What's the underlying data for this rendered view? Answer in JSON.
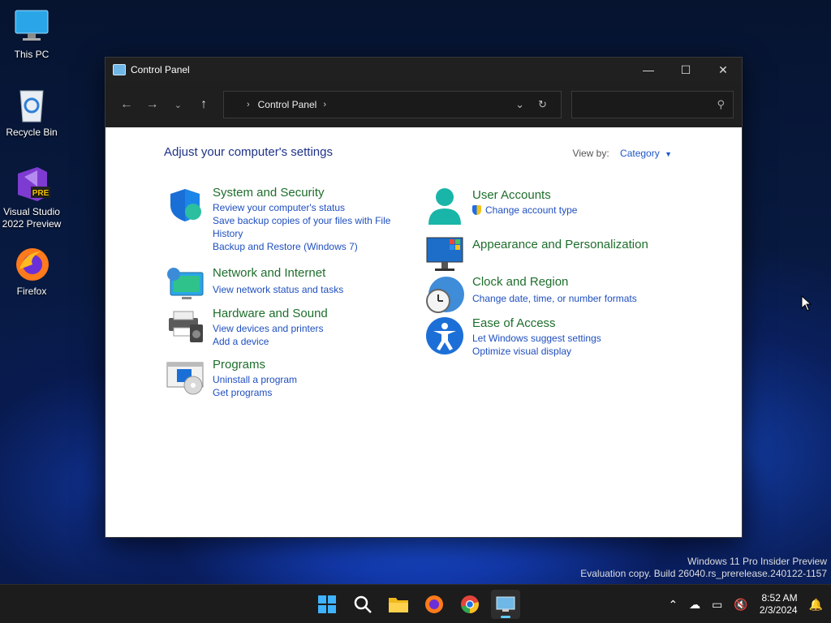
{
  "desktop": {
    "icons": [
      {
        "label": "This PC"
      },
      {
        "label": "Recycle Bin"
      },
      {
        "label": "Visual Studio 2022 Preview",
        "badge": "PRE"
      },
      {
        "label": "Firefox"
      }
    ]
  },
  "window": {
    "title": "Control Panel",
    "controls": {
      "minimize": "—",
      "maximize": "☐",
      "close": "✕"
    },
    "address": {
      "crumb": "Control Panel"
    },
    "search": {
      "placeholder": ""
    }
  },
  "content": {
    "heading": "Adjust your computer's settings",
    "view_by_label": "View by:",
    "view_by_value": "Category",
    "categories": [
      {
        "title": "System and Security",
        "links": [
          "Review your computer's status",
          "Save backup copies of your files with File History",
          "Backup and Restore (Windows 7)"
        ],
        "icon": "shield-icon"
      },
      {
        "title": "Network and Internet",
        "links": [
          "View network status and tasks"
        ],
        "icon": "network-icon"
      },
      {
        "title": "Hardware and Sound",
        "links": [
          "View devices and printers",
          "Add a device"
        ],
        "icon": "printer-icon"
      },
      {
        "title": "Programs",
        "links": [
          "Uninstall a program",
          "Get programs"
        ],
        "icon": "programs-icon"
      },
      {
        "title": "User Accounts",
        "links": [
          "Change account type"
        ],
        "icon": "user-icon"
      },
      {
        "title": "Appearance and Personalization",
        "links": [],
        "icon": "monitor-icon"
      },
      {
        "title": "Clock and Region",
        "links": [
          "Change date, time, or number formats"
        ],
        "icon": "clock-globe-icon"
      },
      {
        "title": "Ease of Access",
        "links": [
          "Let Windows suggest settings",
          "Optimize visual display"
        ],
        "icon": "accessibility-icon"
      }
    ]
  },
  "watermark": {
    "line1": "Windows 11 Pro Insider Preview",
    "line2": "Evaluation copy. Build 26040.rs_prerelease.240122-1157"
  },
  "taskbar": {
    "time": "8:52 AM",
    "date": "2/3/2024"
  },
  "colors": {
    "accent": "#60cdff",
    "link": "#1f4fbf",
    "category_title": "#1e6e2c",
    "heading": "#1e3287"
  }
}
